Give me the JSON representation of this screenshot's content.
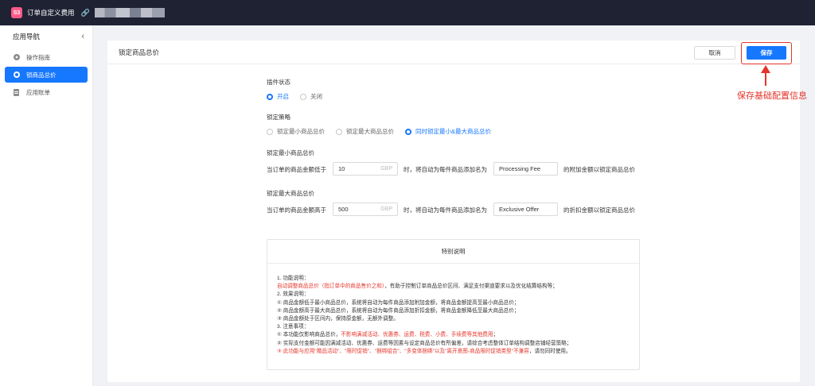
{
  "topbar": {
    "app_badge": "S3",
    "app_title": "订单自定义费用"
  },
  "sidebar": {
    "title": "应用导航",
    "items": [
      {
        "label": "操作指南",
        "icon": "guide-icon"
      },
      {
        "label": "锁商品总价",
        "icon": "gear-icon",
        "active": true
      },
      {
        "label": "应用账单",
        "icon": "document-icon"
      }
    ]
  },
  "page": {
    "title": "锁定商品总价",
    "cancel_label": "取消",
    "save_label": "保存"
  },
  "annotation": {
    "text": "保存基础配置信息",
    "color": "#e5352b"
  },
  "plugin_status": {
    "label": "插件状态",
    "options": [
      "开启",
      "关闭"
    ],
    "selected": "开启"
  },
  "strategy": {
    "label": "锁定策略",
    "options": [
      "锁定最小商品总价",
      "锁定最大商品总价",
      "同时锁定最小&最大商品总价"
    ],
    "selected": "同时锁定最小&最大商品总价"
  },
  "min_lock": {
    "label": "锁定最小商品总价",
    "prefix": "当订单的商品金额低于",
    "amount": "10",
    "currency": "GBP",
    "middle": "时，将自动为每件商品添加名为",
    "fee_name": "Processing Fee",
    "suffix": "的附加金额以锁定商品总价"
  },
  "max_lock": {
    "label": "锁定最大商品总价",
    "prefix": "当订单的商品金额高于",
    "amount": "500",
    "currency": "GBP",
    "middle": "时，将自动为每件商品添加名为",
    "fee_name": "Exclusive Offer",
    "suffix": "的折扣金额以锁定商品总价"
  },
  "notes": {
    "title": "特别说明",
    "l1": "1. 功能说明：",
    "l2": "自动调整商品总价（指订单中的商品售价之和）",
    "l2b": "，有助于控制订单商品总价区间、满足支付渠道要求以及优化结算结构等；",
    "l3": "2. 效果说明：",
    "l4": "① 商品金额低于最小商品总价，系统将自动为每件商品添加附加金额，将商品金额提高至最小商品总价；",
    "l5": "② 商品金额高于最大商品总价，系统将自动为每件商品添加折扣金额，将商品金额降低至最大商品总价；",
    "l6": "③ 商品金额处于区间内，保持原金额，无额外调整。",
    "l7": "3. 注意事项：",
    "l8a": "① 本功能仅影响商品总价，",
    "l8b": "不影响满减活动、优惠券、运费、税费、小费、手续费等其他费用",
    "l8c": "；",
    "l9": "② 实际支付金额可能因满减活动、优惠券、运费等因素与设定商品总价有所偏差，请综合考虑整体订单结构调整店铺经营策略；",
    "l10a": "③ 此功能与应用\"赠品活动\"、\"限时促销\"、\"捆绑组合\"、\"多变体捆绑\"以及\"离开意图-商品限时促销类型\"不兼容",
    "l10b": "，请勿同时使用。"
  }
}
